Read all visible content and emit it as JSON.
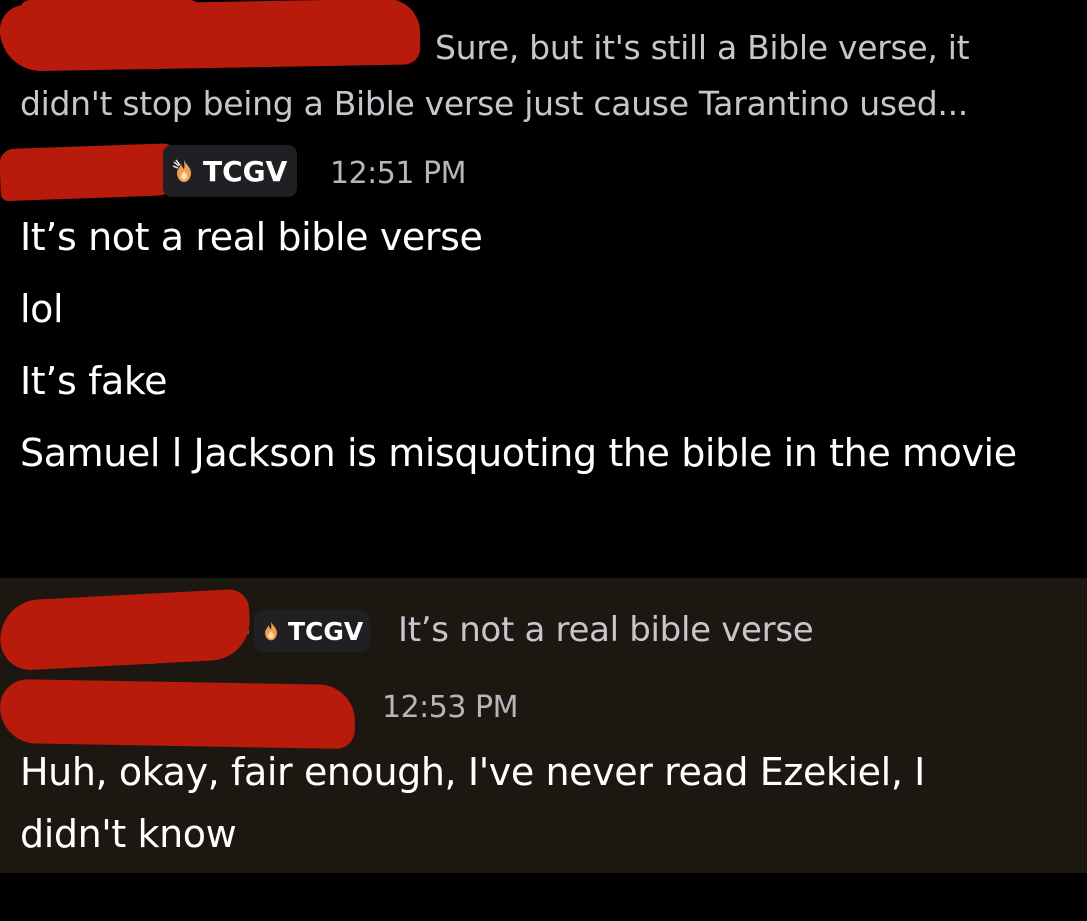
{
  "reply_preview": {
    "text": "Sure, but it's still a Bible verse, it didn't stop being a Bible verse just cause Tarantino used..."
  },
  "message_group_1": {
    "role_tag": "TCGV",
    "role_icon": "flame-icon",
    "timestamp": "12:51 PM",
    "messages": [
      "It’s not a real bible verse",
      "lol",
      "It’s fake",
      "Samuel l Jackson is misquoting the bible in the movie"
    ]
  },
  "message_group_2": {
    "reply": {
      "role_tag": "TCGV",
      "role_icon": "flame-icon",
      "text": "It’s not a real bible verse"
    },
    "timestamp": "12:53 PM",
    "messages": [
      "Huh, okay, fair enough, I've never read Ezekiel, I didn't know"
    ]
  },
  "colors": {
    "background": "#000000",
    "highlight_background": "#1c1811",
    "redaction": "#b81a0c",
    "muted_text": "#c6c6cc",
    "tag_background": "#1f1f24"
  }
}
